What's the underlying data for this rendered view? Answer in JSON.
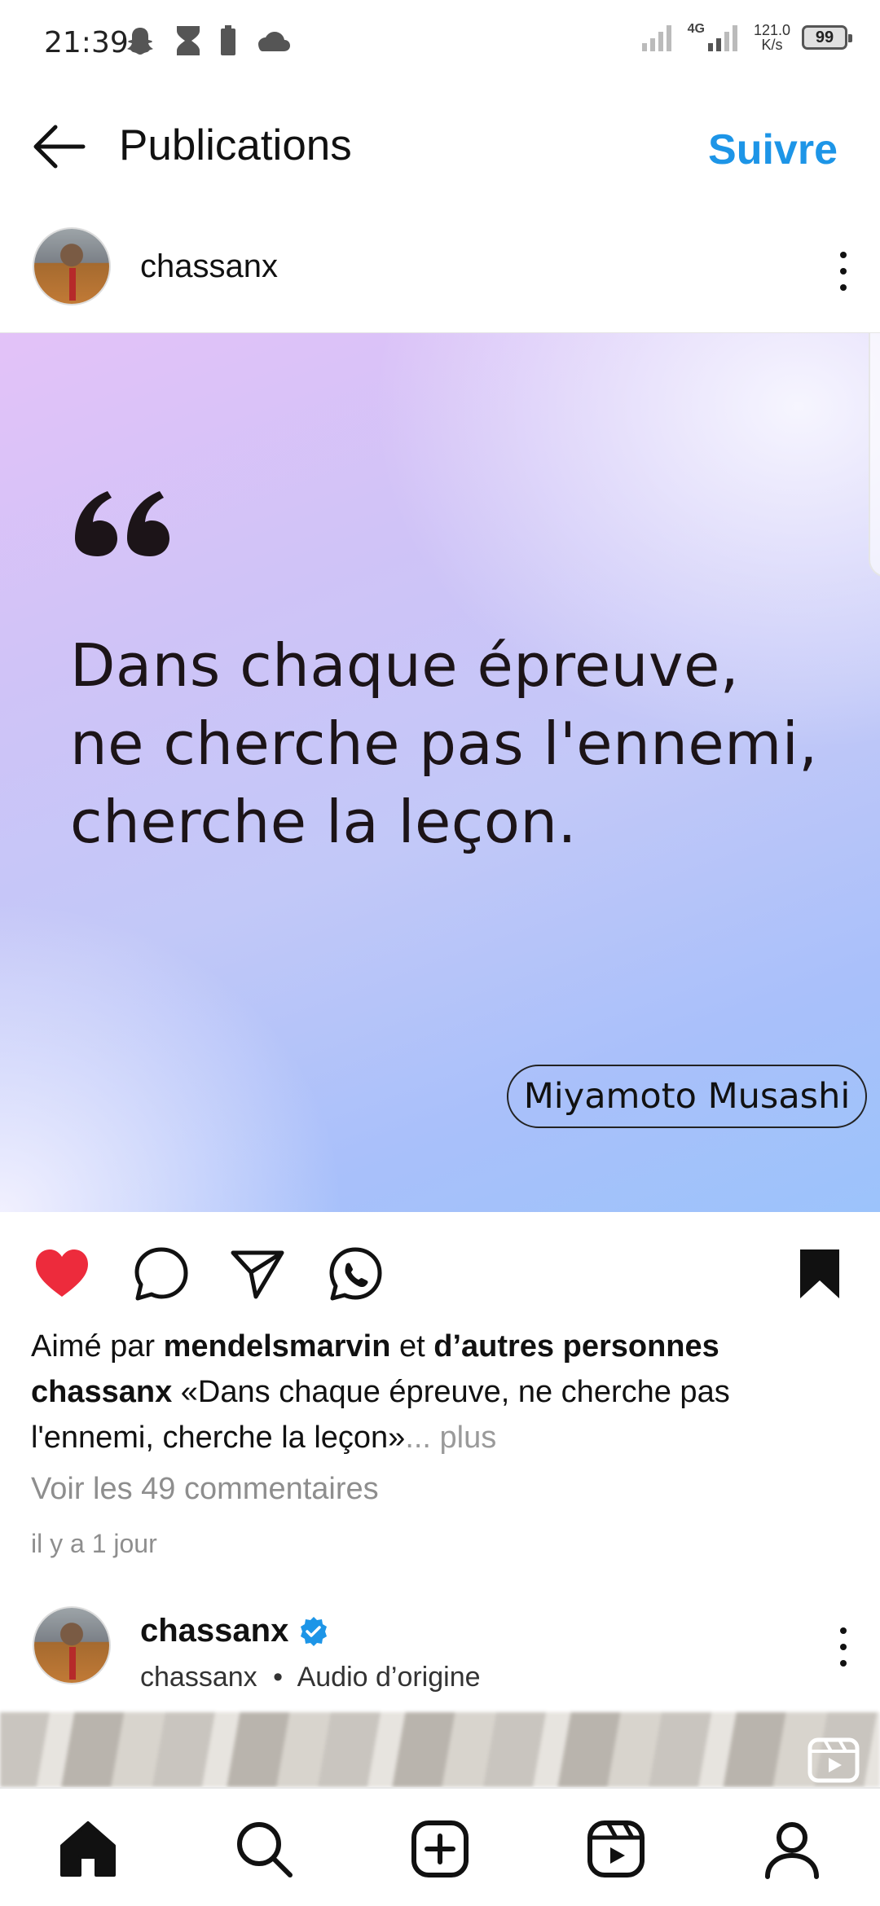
{
  "status_bar": {
    "time": "21:39",
    "network": "4G",
    "speed_value": "121.0",
    "speed_unit": "K/s",
    "battery": "99",
    "icons_left": [
      "snapchat-icon",
      "hourglass-icon",
      "battery-saver-icon",
      "cloud-icon"
    ]
  },
  "header": {
    "title": "Publications",
    "follow_label": "Suivre"
  },
  "post": {
    "username": "chassanx",
    "quote": "Dans chaque épreuve, ne cherche pas l'ennemi, cherche la leçon.",
    "quote_author": "Miyamoto Musashi",
    "liked": true,
    "saved": true,
    "likes_prefix": "Aimé par ",
    "likes_user": "mendelsmarvin",
    "likes_mid": " et ",
    "likes_others": "d’autres personnes",
    "caption_user": "chassanx",
    "caption_text": " «Dans chaque épreuve, ne cherche pas l'ennemi, cherche la leçon»",
    "caption_more": "... plus",
    "comments_link": "Voir les 49 commentaires",
    "time_ago": "il y a 1 jour"
  },
  "next_post": {
    "username": "chassanx",
    "verified": true,
    "sub_user": "chassanx",
    "separator": "•",
    "audio": "Audio d’origine"
  },
  "colors": {
    "accent": "#1d95e7",
    "like": "#ed2b3c",
    "verified": "#1d95e7"
  },
  "bottom_nav": [
    "home-icon",
    "search-icon",
    "create-icon",
    "reels-icon",
    "profile-icon"
  ]
}
